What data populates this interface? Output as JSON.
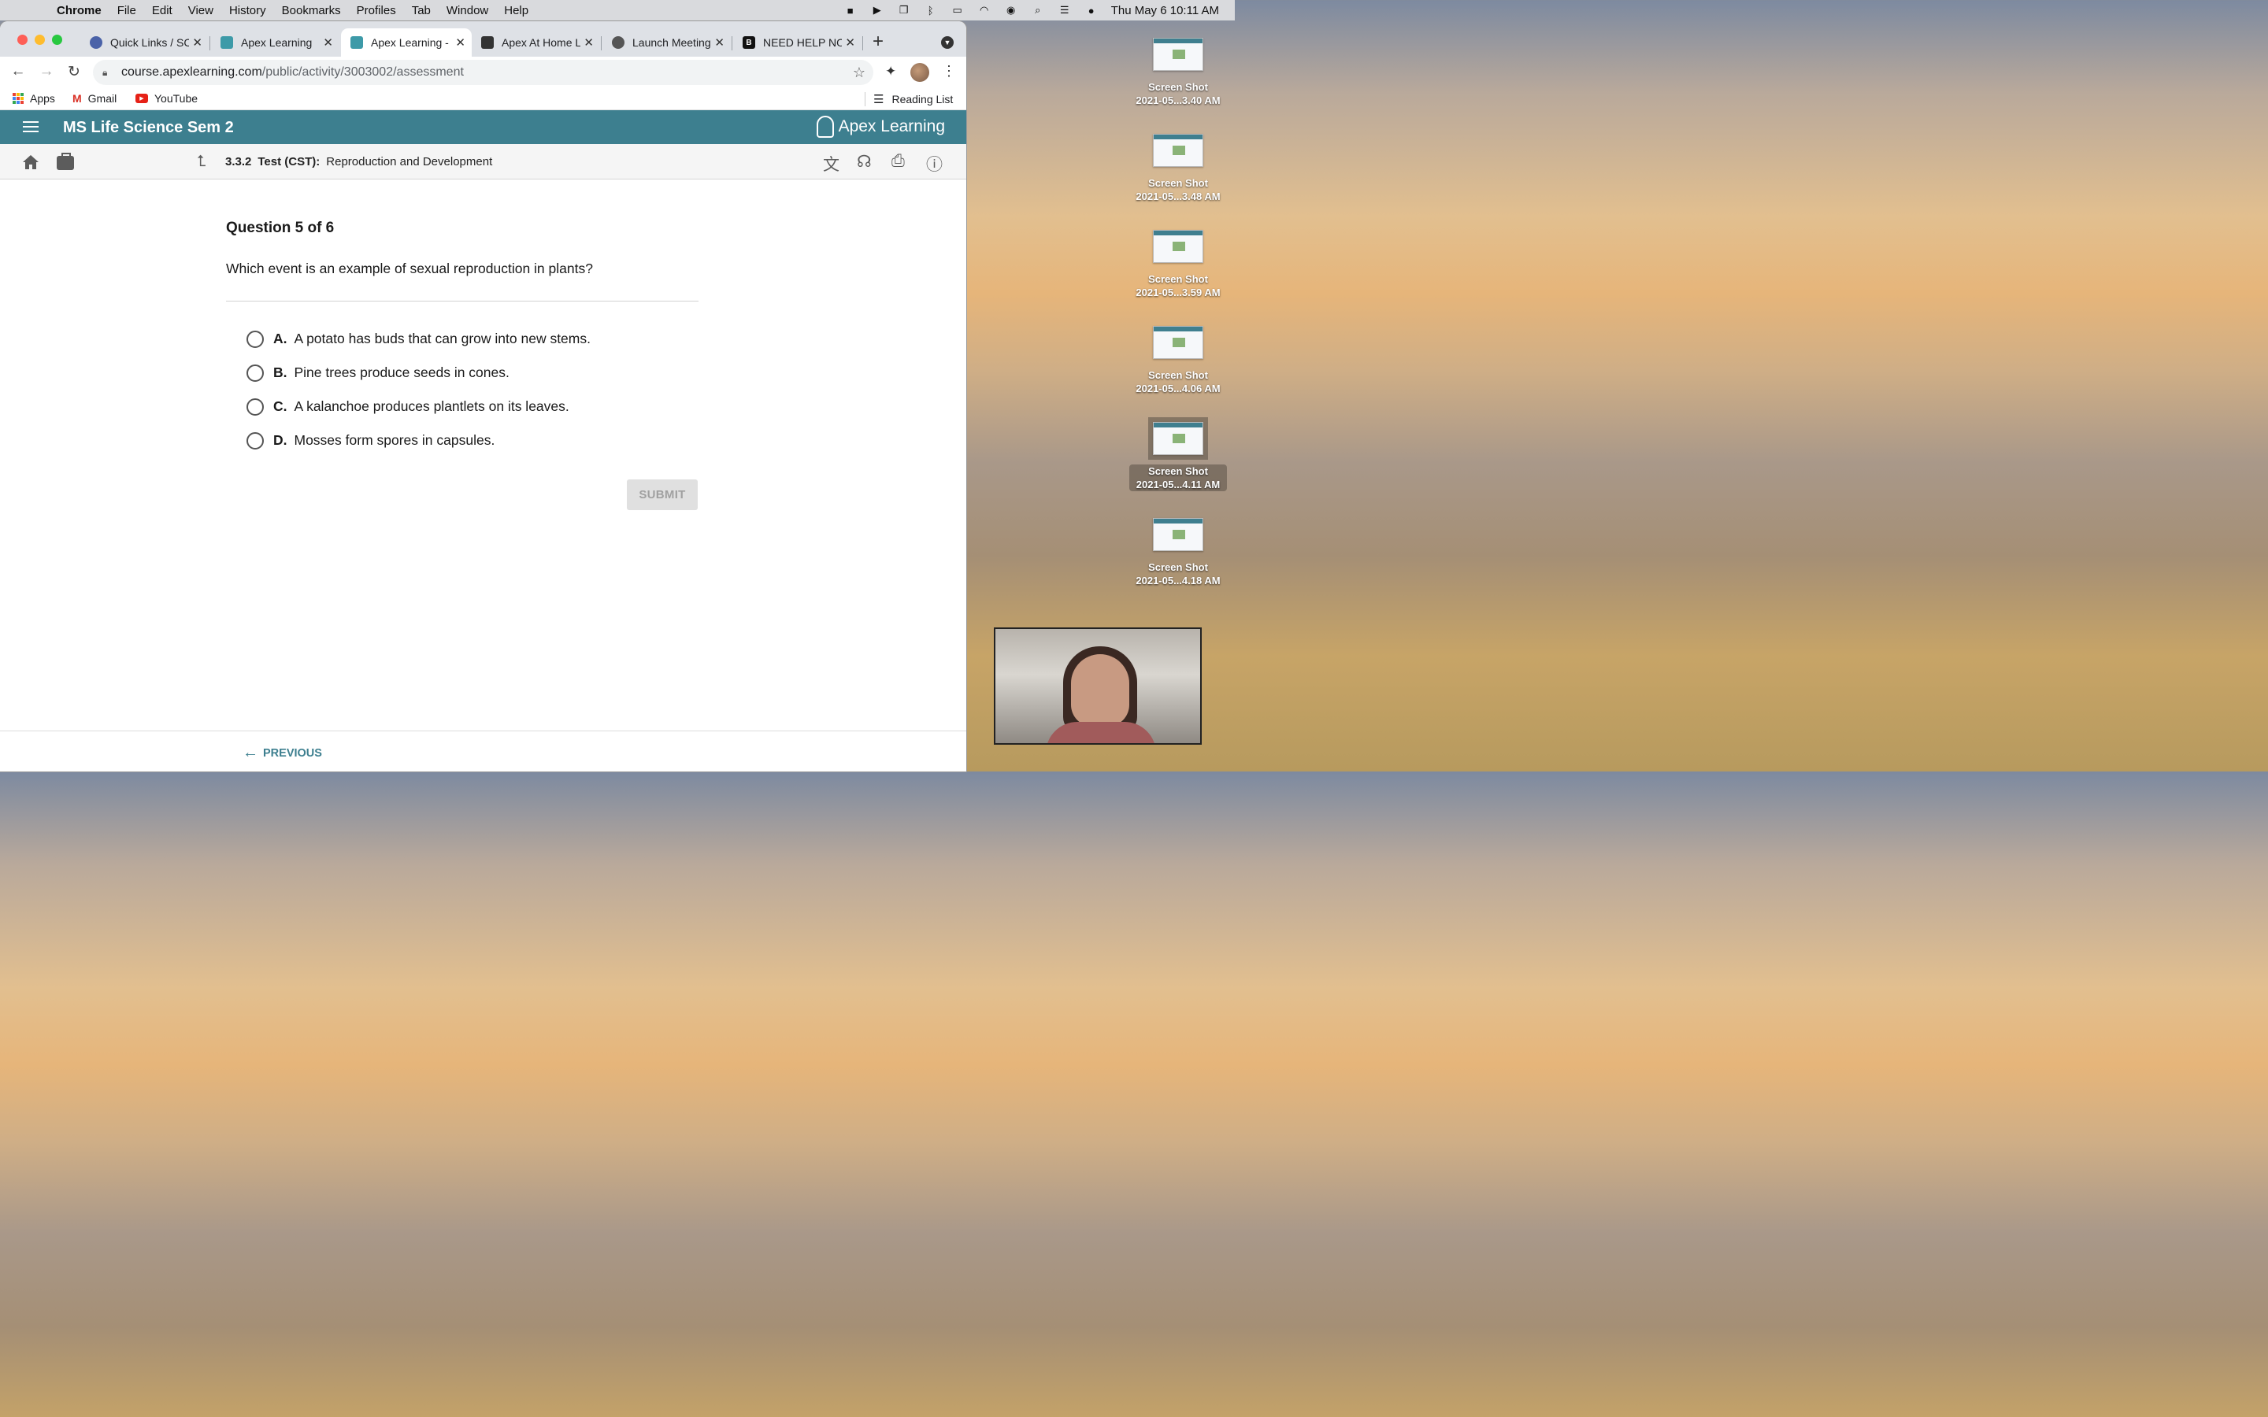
{
  "menubar": {
    "app": "Chrome",
    "items": [
      "File",
      "Edit",
      "View",
      "History",
      "Bookmarks",
      "Profiles",
      "Tab",
      "Window",
      "Help"
    ],
    "clock": "Thu May 6  10:11 AM"
  },
  "browser": {
    "tabs": [
      {
        "title": "Quick Links / SC",
        "favicon_color": "#4a62a8"
      },
      {
        "title": "Apex Learning",
        "favicon_color": "#3d9aa8"
      },
      {
        "title": "Apex Learning -",
        "favicon_color": "#3d9aa8"
      },
      {
        "title": "Apex At Home L",
        "favicon_color": "#333333"
      },
      {
        "title": "Launch Meeting",
        "favicon_color": "#555555"
      },
      {
        "title": "NEED HELP NO",
        "favicon_color": "#111111"
      }
    ],
    "url_host": "course.apexlearning.com",
    "url_path": "/public/activity/3003002/assessment",
    "bookmarks": [
      "Apps",
      "Gmail",
      "YouTube"
    ],
    "reading_list": "Reading List"
  },
  "apex": {
    "course_title": "MS Life Science Sem 2",
    "logo_text": "Apex Learning",
    "breadcrumb": {
      "number": "3.3.2",
      "type": "Test (CST):",
      "title": "Reproduction and Development"
    },
    "question_counter": "Question 5 of 6",
    "question_text": "Which event is an example of sexual reproduction in plants?",
    "options": [
      {
        "letter": "A.",
        "text": "A potato has buds that can grow into new stems."
      },
      {
        "letter": "B.",
        "text": "Pine trees produce seeds in cones."
      },
      {
        "letter": "C.",
        "text": "A kalanchoe produces plantlets on its leaves."
      },
      {
        "letter": "D.",
        "text": "Mosses form spores in capsules."
      }
    ],
    "submit_label": "SUBMIT",
    "previous_label": "PREVIOUS",
    "accent_color": "#3d7f8f"
  },
  "desktop": {
    "files": [
      {
        "line1": "Screen Shot",
        "line2": "2021-05...3.40 AM"
      },
      {
        "line1": "Screen Shot",
        "line2": "2021-05...3.48 AM"
      },
      {
        "line1": "Screen Shot",
        "line2": "2021-05...3.59 AM"
      },
      {
        "line1": "Screen Shot",
        "line2": "2021-05...4.06 AM"
      },
      {
        "line1": "Screen Shot",
        "line2": "2021-05...4.11 AM"
      },
      {
        "line1": "Screen Shot",
        "line2": "2021-05...4.18 AM"
      }
    ]
  }
}
